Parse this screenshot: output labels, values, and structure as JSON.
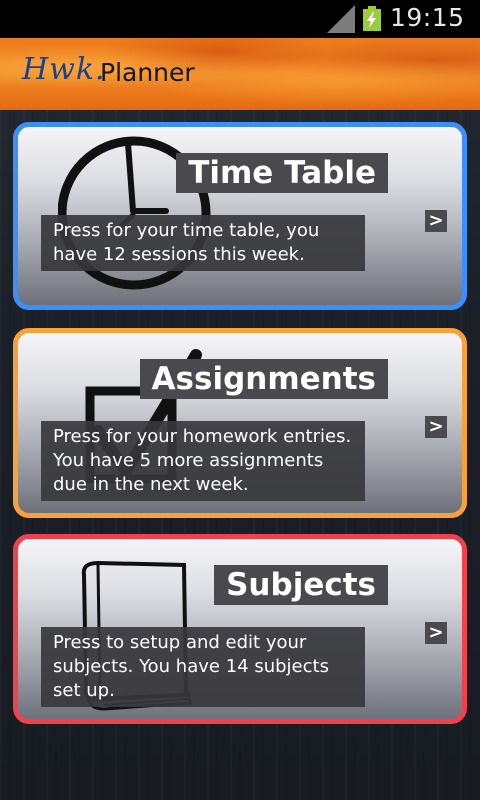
{
  "status_bar": {
    "time": "19:15"
  },
  "header": {
    "logo_text": "Hwk.",
    "title": "Planner"
  },
  "cards": [
    {
      "title": "Time Table",
      "description": "Press for your time table, you have 12 sessions this week.",
      "border_color": "#3d8ef5",
      "icon": "clock-icon",
      "arrow": ">"
    },
    {
      "title": "Assignments",
      "description": "Press for your homework entries. You have 5 more assignments due in the next week.",
      "border_color": "#f7a13b",
      "icon": "checkbox-icon",
      "arrow": ">"
    },
    {
      "title": "Subjects",
      "description": "Press to setup and edit your subjects. You have 14 subjects set up.",
      "border_color": "#f0414e",
      "icon": "book-icon",
      "arrow": ">"
    }
  ]
}
